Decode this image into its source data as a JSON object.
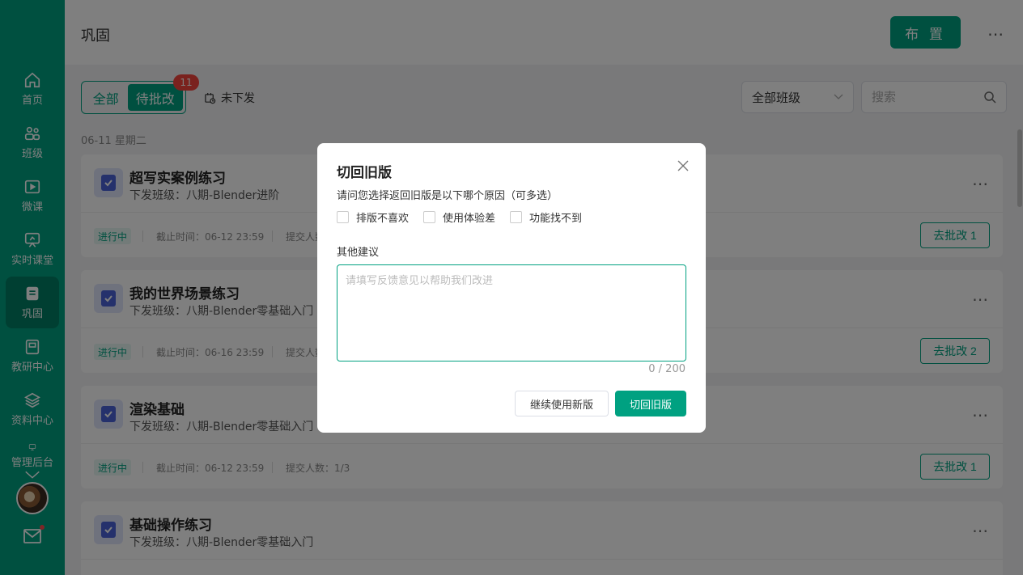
{
  "colors": {
    "brand": "#00a181",
    "brand_dark": "#007e64",
    "badge": "#f5443c"
  },
  "sidebar": {
    "items": [
      {
        "label": "首页",
        "icon": "home-icon"
      },
      {
        "label": "班级",
        "icon": "users-icon"
      },
      {
        "label": "微课",
        "icon": "video-board-icon"
      },
      {
        "label": "实时课堂",
        "icon": "live-class-icon"
      },
      {
        "label": "巩固",
        "icon": "notebook-icon"
      },
      {
        "label": "教研中心",
        "icon": "research-icon"
      },
      {
        "label": "资料中心",
        "icon": "layers-icon"
      },
      {
        "label": "管理后台",
        "icon": "monitor-icon"
      }
    ]
  },
  "header": {
    "title": "巩固",
    "assign_label": "布 置",
    "more": "⋯"
  },
  "toolbar": {
    "tab_all": "全部",
    "tab_pending": "待批改",
    "pending_badge": "11",
    "unissued": "未下发",
    "class_select": "全部班级",
    "search_placeholder": "搜索"
  },
  "date_label": "06-11 星期二",
  "cards": [
    {
      "title": "超写实案例练习",
      "class": "下发班级：八期-Blender进阶",
      "status": "进行中",
      "deadline": "截止时间：06-12 23:59",
      "submitted": "提交人数",
      "action": "去批改 1"
    },
    {
      "title": "我的世界场景练习",
      "class": "下发班级：八期-Blender零基础入门",
      "status": "进行中",
      "deadline": "截止时间：06-16 23:59",
      "submitted": "提交人数",
      "action": "去批改 2"
    },
    {
      "title": "渲染基础",
      "class": "下发班级：八期-Blender零基础入门",
      "status": "进行中",
      "deadline": "截止时间：06-12 23:59",
      "submitted": "提交人数：1/3",
      "action": "去批改 1"
    },
    {
      "title": "基础操作练习",
      "class": "下发班级：八期-Blender零基础入门",
      "more": "⋯"
    }
  ],
  "modal": {
    "title": "切回旧版",
    "question": "请问您选择返回旧版是以下哪个原因（可多选）",
    "options": [
      "排版不喜欢",
      "使用体验差",
      "功能找不到"
    ],
    "other_label": "其他建议",
    "placeholder": "请填写反馈意见以帮助我们改进",
    "counter": "0 / 200",
    "keep_label": "继续使用新版",
    "back_label": "切回旧版"
  }
}
